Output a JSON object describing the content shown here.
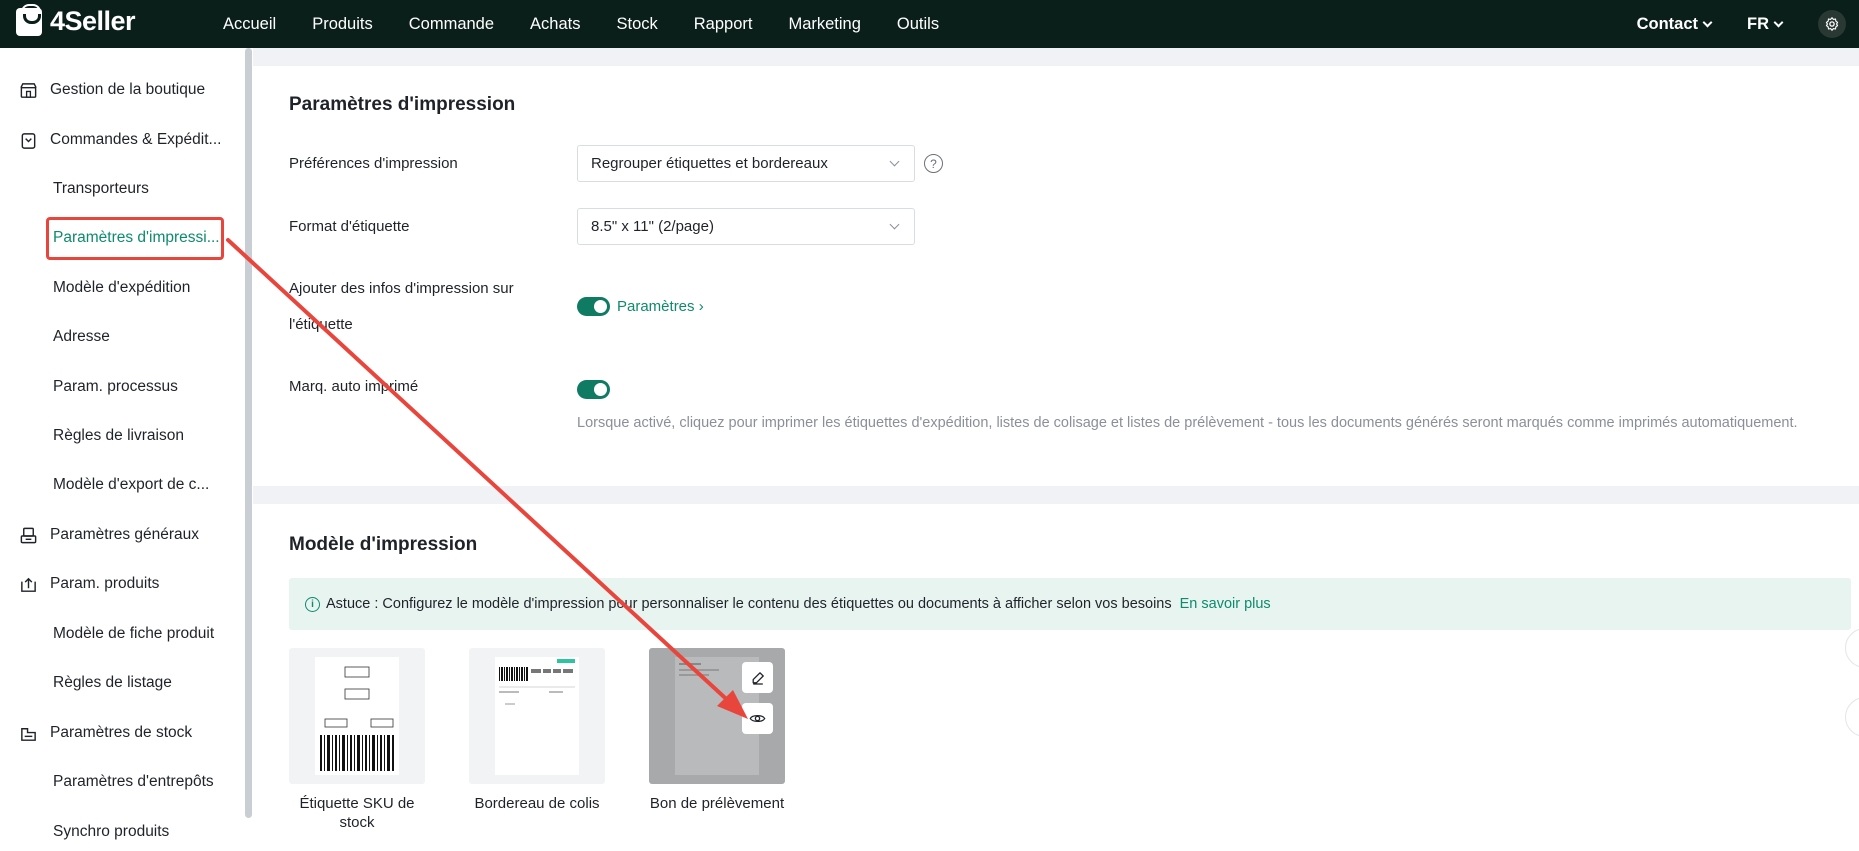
{
  "app": {
    "name": "4Seller"
  },
  "nav": {
    "items": [
      "Accueil",
      "Produits",
      "Commande",
      "Achats",
      "Stock",
      "Rapport",
      "Marketing",
      "Outils"
    ],
    "contact": "Contact",
    "lang": "FR"
  },
  "sidebar": {
    "items": [
      {
        "label": "Gestion de la boutique",
        "type": "group",
        "icon": "store-icon"
      },
      {
        "label": "Commandes & Expédit...",
        "type": "group",
        "icon": "order-icon"
      },
      {
        "label": "Transporteurs",
        "type": "sub"
      },
      {
        "label": "Paramètres d'impressi...",
        "type": "sub",
        "active": true
      },
      {
        "label": "Modèle d'expédition",
        "type": "sub"
      },
      {
        "label": "Adresse",
        "type": "sub"
      },
      {
        "label": "Param. processus",
        "type": "sub"
      },
      {
        "label": "Règles de livraison",
        "type": "sub"
      },
      {
        "label": "Modèle d'export de c...",
        "type": "sub"
      },
      {
        "label": "Paramètres généraux",
        "type": "group",
        "icon": "general-icon"
      },
      {
        "label": "Param. produits",
        "type": "group",
        "icon": "product-icon"
      },
      {
        "label": "Modèle de fiche produit",
        "type": "sub"
      },
      {
        "label": "Règles de listage",
        "type": "sub"
      },
      {
        "label": "Paramètres de stock",
        "type": "group",
        "icon": "stock-icon"
      },
      {
        "label": "Paramètres d'entrepôts",
        "type": "sub"
      },
      {
        "label": "Synchro produits",
        "type": "sub"
      }
    ]
  },
  "print_settings": {
    "title": "Paramètres d'impression",
    "pref_label": "Préférences d'impression",
    "pref_value": "Regrouper étiquettes et bordereaux",
    "help": "?",
    "format_label": "Format d'étiquette",
    "format_value": "8.5\" x 11\" (2/page)",
    "add_info_label_1": "Ajouter des infos d'impression sur",
    "add_info_label_2": "l'étiquette",
    "add_info_enabled": true,
    "params_link": "Paramètres",
    "auto_mark_label": "Marq. auto imprimé",
    "auto_mark_enabled": true,
    "auto_mark_desc": "Lorsque activé, cliquez pour imprimer les étiquettes d'expédition, listes de colisage et listes de prélèvement - tous les documents générés seront marqués comme imprimés automatiquement."
  },
  "print_templates": {
    "title": "Modèle d'impression",
    "tip_text": "Astuce : Configurez le modèle d'impression pour personnaliser le contenu des étiquettes ou documents à afficher selon vos besoins",
    "tip_link": "En savoir plus",
    "cards": [
      {
        "label_1": "Étiquette SKU de",
        "label_2": "stock",
        "icon": "sku-label-thumbnail"
      },
      {
        "label_1": "Bordereau de colis",
        "label_2": "",
        "icon": "packing-slip-thumbnail"
      },
      {
        "label_1": "Bon de prélèvement",
        "label_2": "",
        "icon": "pick-list-thumbnail"
      }
    ]
  },
  "colors": {
    "accent": "#0e8a6e",
    "topbar": "#0b1f1a",
    "annotation": "#e8453c"
  }
}
